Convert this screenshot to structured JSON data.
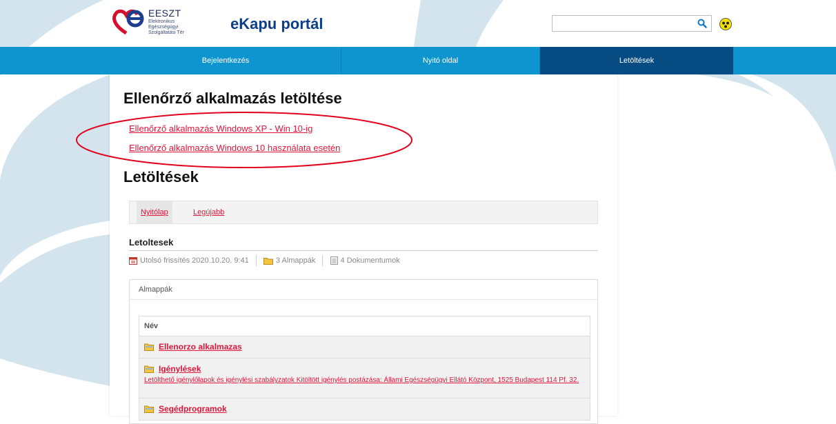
{
  "header": {
    "logo_title": "EESZT",
    "logo_subtitle_lines": [
      "Elektronikus",
      "Egészségügyi",
      "Szolgáltatási Tér"
    ],
    "portal_title": "eKapu portál",
    "search_placeholder": "",
    "search_icon": "search-icon",
    "accessibility_icon": "accessibility-icon"
  },
  "nav": {
    "items": [
      {
        "label": "Bejelentkezés"
      },
      {
        "label": "Nyitó oldal"
      },
      {
        "label": "Letöltések",
        "active": true
      }
    ]
  },
  "main": {
    "title": "Ellenőrző alkalmazás letöltése",
    "links": [
      "Ellenőrző alkalmazás Windows XP - Win 10-ig",
      "Ellenőrző alkalmazás Windows 10 használata esetén"
    ],
    "downloads_title": "Letöltések",
    "tabs": [
      {
        "label": "Nyitólap",
        "active": true
      },
      {
        "label": "Legújabb"
      }
    ],
    "folder_name": "Letoltesek",
    "meta": {
      "last_updated": "Utolsó frissítés 2020.10.20. 9:41",
      "subfolders": "3 Almappák",
      "documents": "4 Dokumentumok"
    },
    "subfolders_panel": {
      "title": "Almappák",
      "column_header": "Név",
      "rows": [
        {
          "name": "Ellenorzo alkalmazas",
          "description": ""
        },
        {
          "name": "Igénylések",
          "description": "Letölthető igénylőlapok és igénylési szabályzatok Kitöltött igénylés postázása: Állami Egészségügyi Ellátó Központ, 1525 Budapest 114 Pf. 32."
        },
        {
          "name": "Segédprogramok",
          "description": ""
        }
      ]
    }
  },
  "colors": {
    "nav_bg": "#0e95cf",
    "nav_active": "#064b82",
    "link": "#e0153a",
    "title_blue": "#0d3d87",
    "annotation": "#e3001b"
  }
}
